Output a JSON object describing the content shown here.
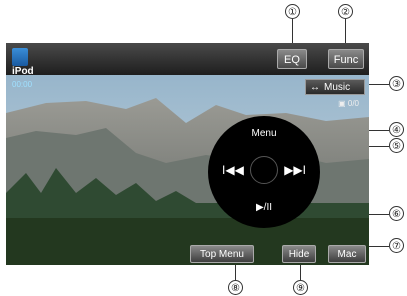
{
  "callouts": [
    "①",
    "②",
    "③",
    "④",
    "⑤",
    "⑥",
    "⑦",
    "⑧",
    "⑨"
  ],
  "header": {
    "eq_label": "EQ",
    "func_label": "Func"
  },
  "source": {
    "icon": "ipod-icon",
    "label": "iPod",
    "time": "00:00"
  },
  "music_toggle": {
    "arrow": "↔",
    "label": "Music"
  },
  "status_icons": "▣ 0/0",
  "control_circle": {
    "menu_label": "Menu",
    "prev_label": "I◀◀",
    "next_label": "▶▶I",
    "play_pause_label": "▶/II"
  },
  "bottom_bar": {
    "top_menu_label": "Top Menu",
    "hide_label": "Hide",
    "mac_label": "Mac"
  }
}
